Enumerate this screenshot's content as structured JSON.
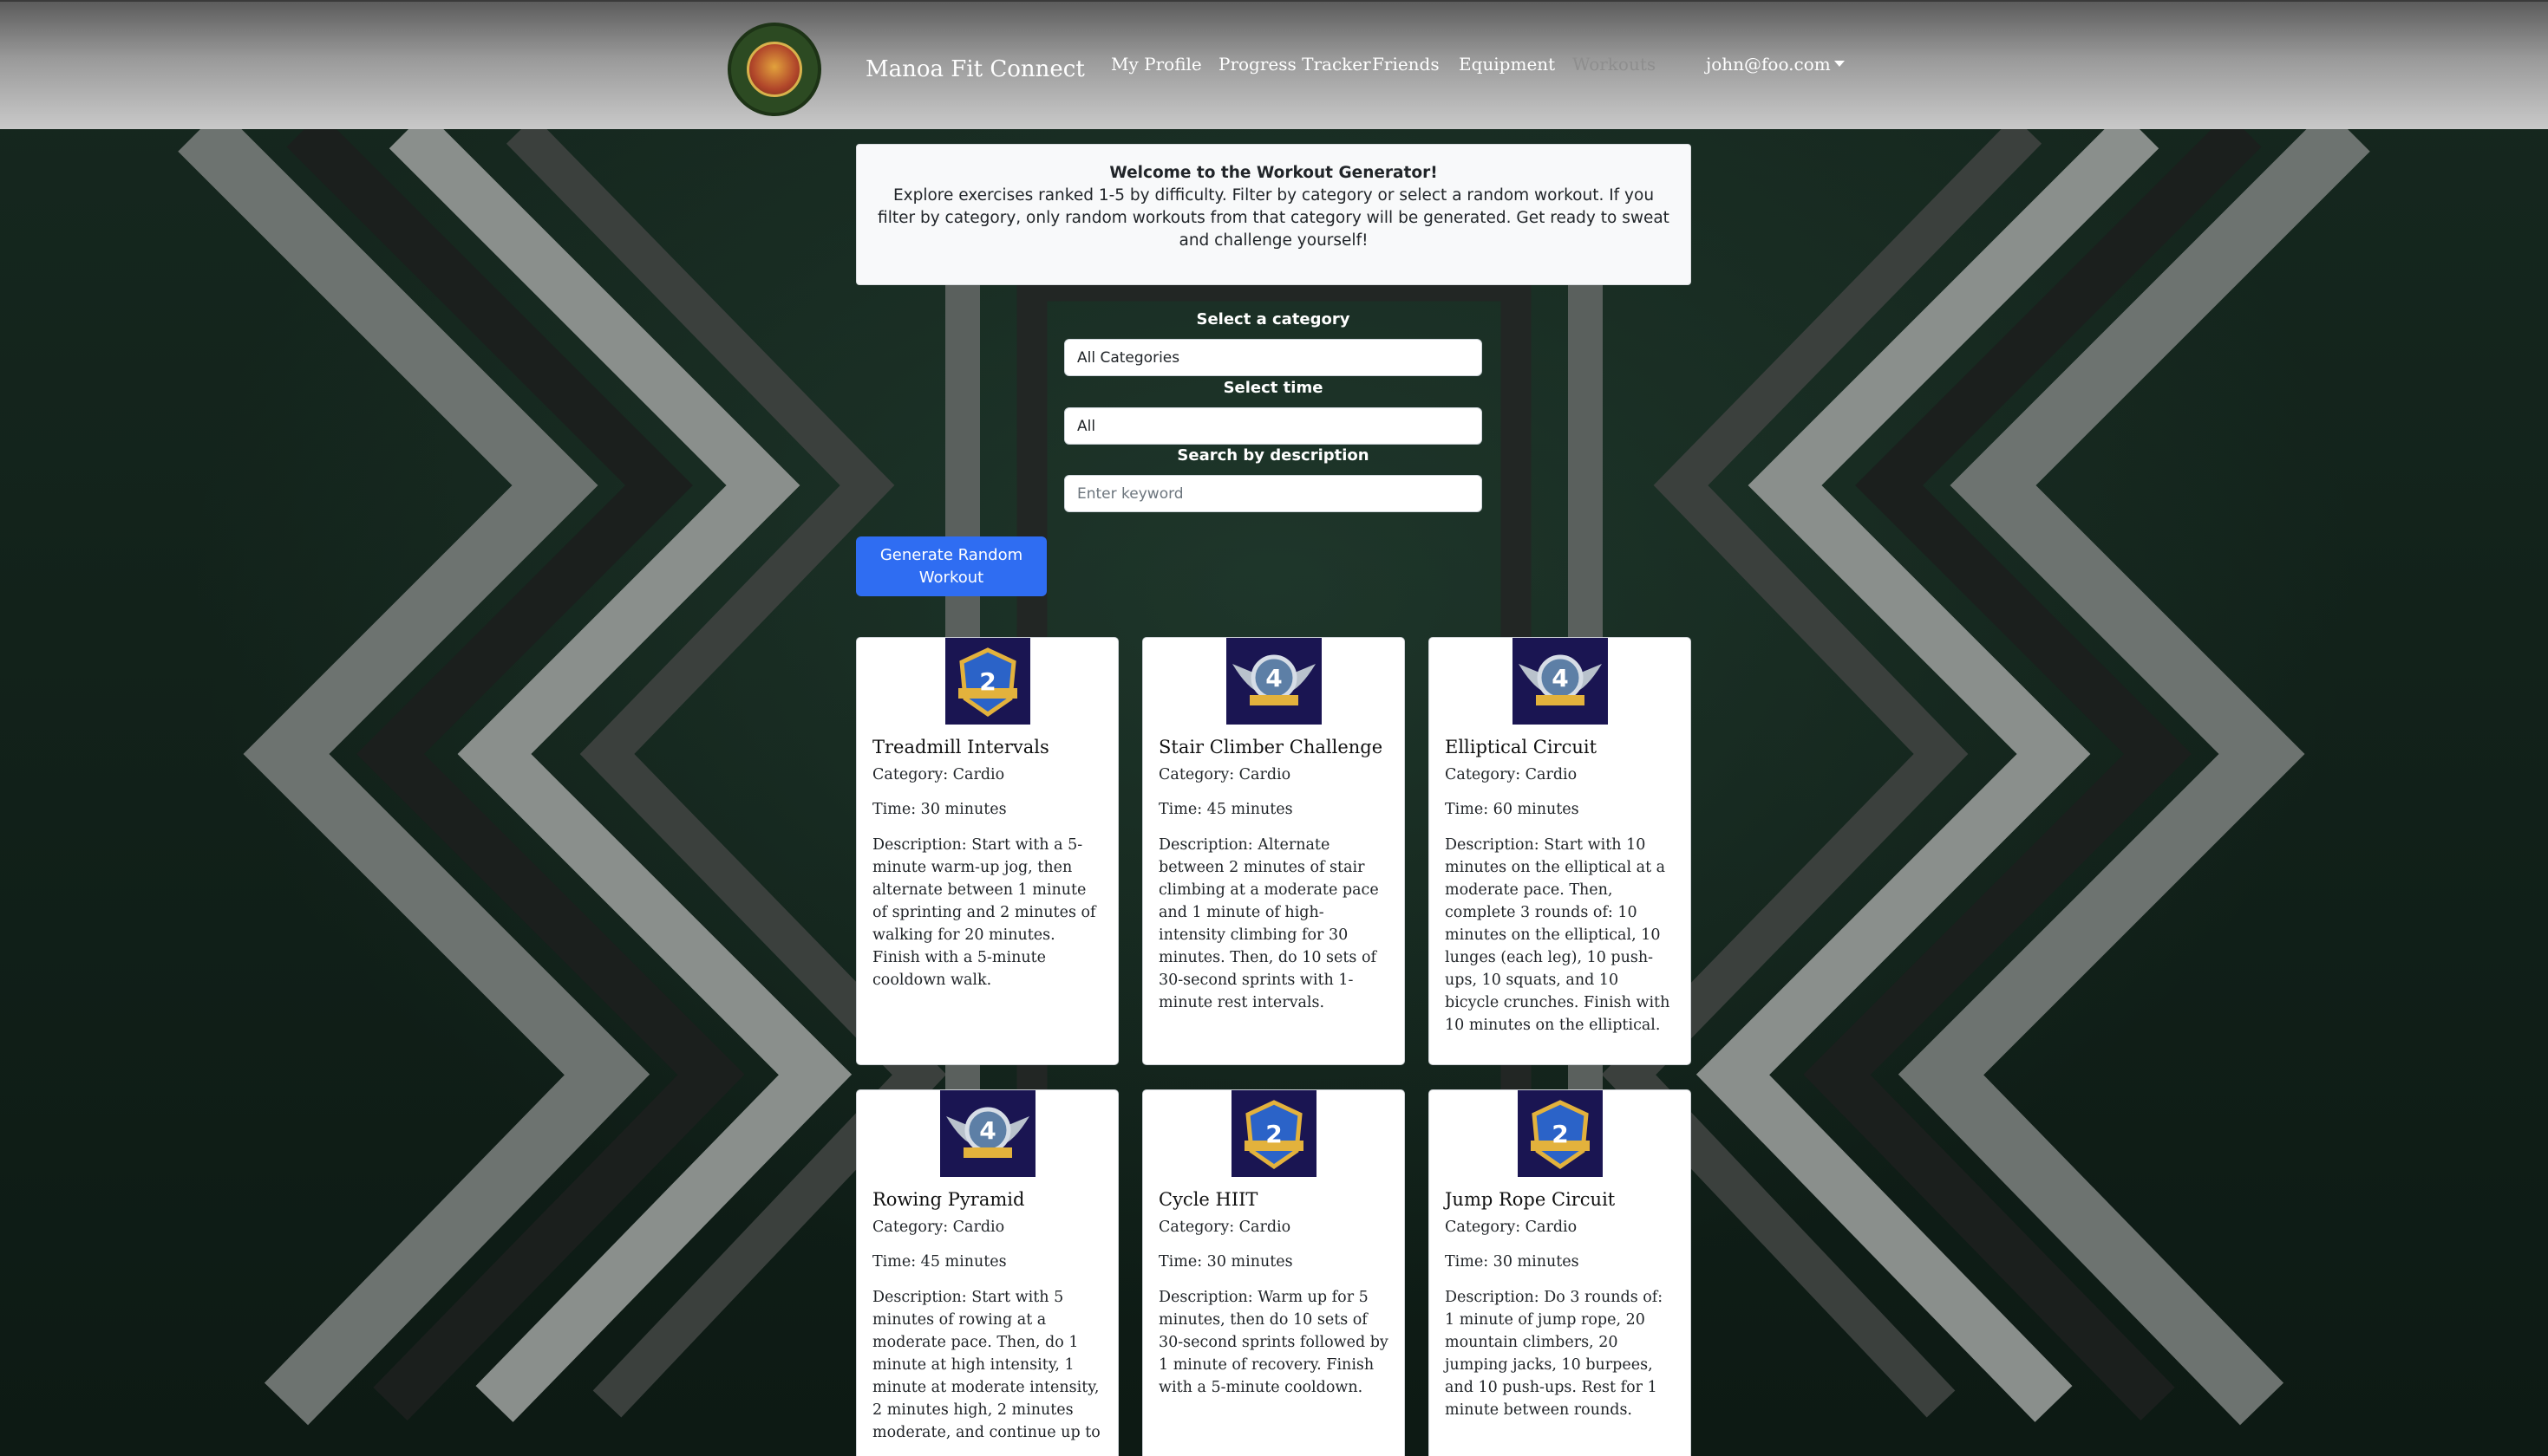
{
  "navbar": {
    "brand": "Manoa Fit Connect",
    "links": [
      "My Profile",
      "Progress Tracker",
      "Friends",
      "Equipment",
      "Workouts"
    ],
    "active": "Workouts",
    "user": "john@foo.com",
    "logo_icon": "manoa-fit-connect-logo"
  },
  "intro": {
    "title": "Welcome to the Workout Generator!",
    "text": "Explore exercises ranked 1-5 by difficulty. Filter by category or select a random workout. If you filter by category, only random workouts from that category will be generated. Get ready to sweat and challenge yourself!"
  },
  "filters": {
    "category_label": "Select a category",
    "category_value": "All Categories",
    "time_label": "Select time",
    "time_value": "All",
    "search_label": "Search by description",
    "search_placeholder": "Enter keyword"
  },
  "generate_button": "Generate Random Workout",
  "workouts": [
    {
      "title": "Treadmill Intervals",
      "category": "Category: Cardio",
      "time": "Time: 30 minutes",
      "description": "Description: Start with a 5-minute warm-up jog, then alternate between 1 minute of sprinting and 2 minutes of walking for 20 minutes. Finish with a 5-minute cooldown walk.",
      "level": "2"
    },
    {
      "title": "Stair Climber Challenge",
      "category": "Category: Cardio",
      "time": "Time: 45 minutes",
      "description": "Description: Alternate between 2 minutes of stair climbing at a moderate pace and 1 minute of high-intensity climbing for 30 minutes. Then, do 10 sets of 30-second sprints with 1-minute rest intervals.",
      "level": "4"
    },
    {
      "title": "Elliptical Circuit",
      "category": "Category: Cardio",
      "time": "Time: 60 minutes",
      "description": "Description: Start with 10 minutes on the elliptical at a moderate pace. Then, complete 3 rounds of: 10 minutes on the elliptical, 10 lunges (each leg), 10 push-ups, 10 squats, and 10 bicycle crunches. Finish with 10 minutes on the elliptical.",
      "level": "4"
    },
    {
      "title": "Rowing Pyramid",
      "category": "Category: Cardio",
      "time": "Time: 45 minutes",
      "description": "Description: Start with 5 minutes of rowing at a moderate pace. Then, do 1 minute at high intensity, 1 minute at moderate intensity, 2 minutes high, 2 minutes moderate, and continue up to",
      "level": "4"
    },
    {
      "title": "Cycle HIIT",
      "category": "Category: Cardio",
      "time": "Time: 30 minutes",
      "description": "Description: Warm up for 5 minutes, then do 10 sets of 30-second sprints followed by 1 minute of recovery. Finish with a 5-minute cooldown.",
      "level": "2"
    },
    {
      "title": "Jump Rope Circuit",
      "category": "Category: Cardio",
      "time": "Time: 30 minutes",
      "description": "Description: Do 3 rounds of: 1 minute of jump rope, 20 mountain climbers, 20 jumping jacks, 10 burpees, and 10 push-ups. Rest for 1 minute between rounds.",
      "level": "2"
    }
  ]
}
